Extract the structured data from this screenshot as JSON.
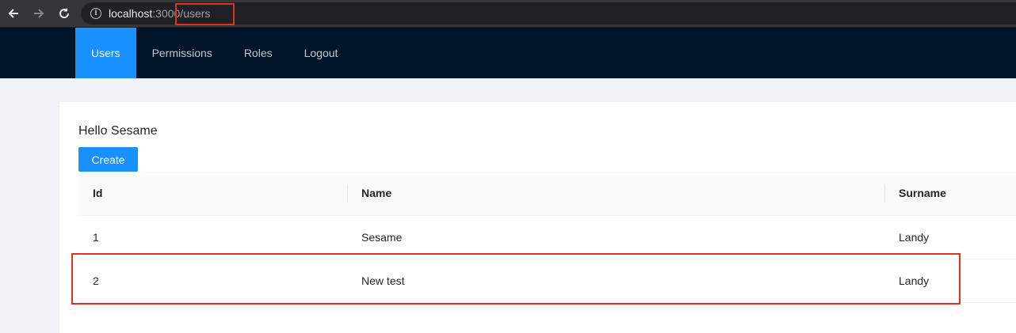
{
  "browser": {
    "url_host": "localhost",
    "url_path": ":3000/users"
  },
  "menu": {
    "items": [
      {
        "label": "Users",
        "active": true
      },
      {
        "label": "Permissions",
        "active": false
      },
      {
        "label": "Roles",
        "active": false
      },
      {
        "label": "Logout",
        "active": false
      }
    ]
  },
  "page": {
    "greeting": "Hello Sesame",
    "create_label": "Create"
  },
  "table": {
    "columns": [
      "Id",
      "Name",
      "Surname"
    ],
    "rows": [
      [
        "1",
        "Sesame",
        "Landy"
      ],
      [
        "2",
        "New test",
        "Landy"
      ]
    ]
  },
  "colors": {
    "header_bg": "#001529",
    "accent": "#1890ff",
    "highlight": "#e0301e"
  }
}
